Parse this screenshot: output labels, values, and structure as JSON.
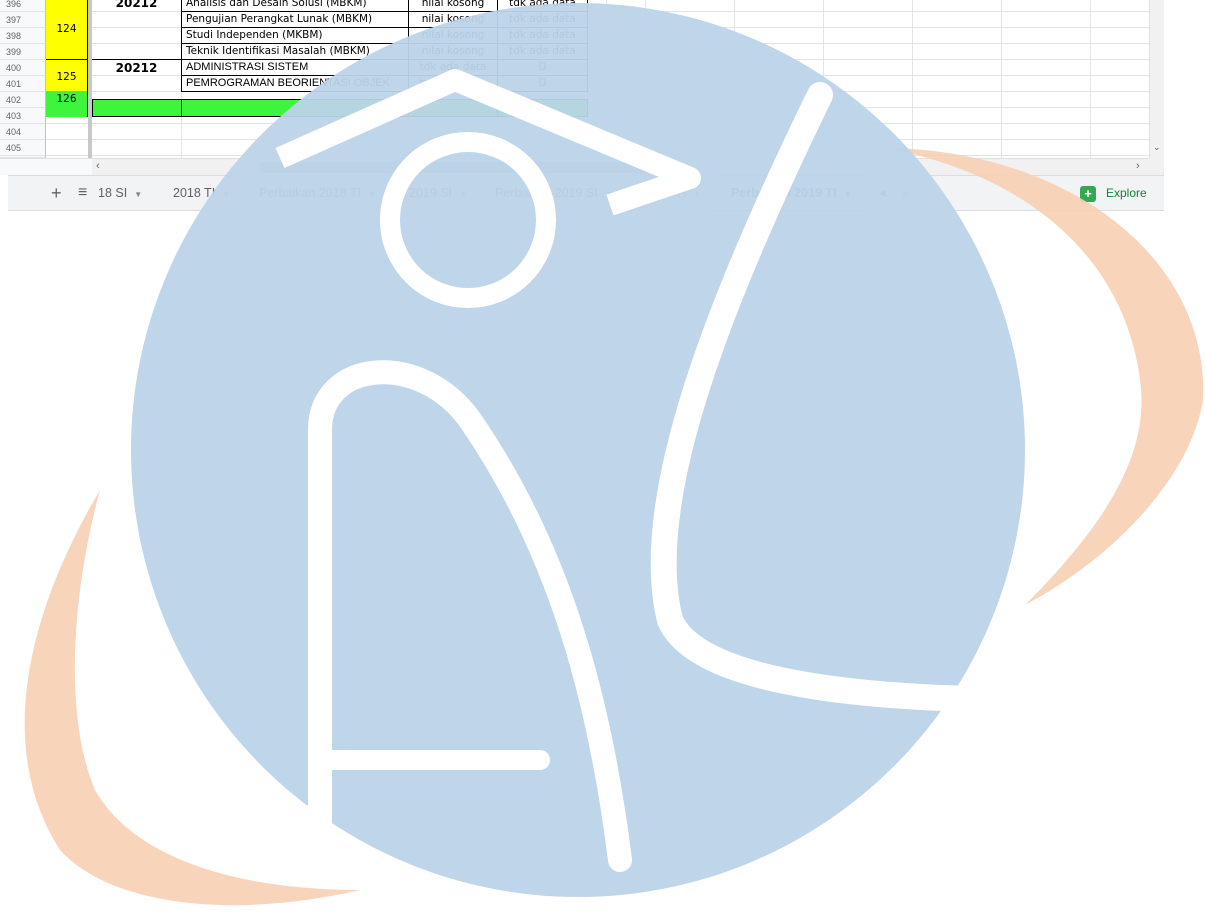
{
  "rows": [
    "396",
    "397",
    "398",
    "399",
    "400",
    "401",
    "402",
    "403",
    "404",
    "405"
  ],
  "groups": {
    "g124": "124",
    "g125": "125",
    "g126": "126"
  },
  "terms": {
    "t396": "20212",
    "t400": "20212"
  },
  "courses": [
    {
      "name": "Analisis dan Desain Solusi (MBKM)",
      "nilai": "nilai kosong",
      "status": "tdk ada data"
    },
    {
      "name": "Pengujian Perangkat Lunak (MBKM)",
      "nilai": "nilai kosong",
      "status": "tdk ada data"
    },
    {
      "name": "Studi Independen (MKBM)",
      "nilai": "nilai kosong",
      "status": "tdk ada data"
    },
    {
      "name": "Teknik Identifikasi Masalah (MBKM)",
      "nilai": "nilai kosong",
      "status": "tdk ada data"
    },
    {
      "name": "ADMINISTRASI SISTEM",
      "nilai": "tdk ada data",
      "status": "D"
    },
    {
      "name": "PEMROGRAMAN BEORIENTASI OBJEK",
      "nilai": "tdk ada data",
      "status": "D"
    }
  ],
  "tabs": [
    {
      "label": "18 SI"
    },
    {
      "label": "2018 TI"
    },
    {
      "label": "Perbaikan 2018 TI"
    },
    {
      "label": "2019 SI"
    },
    {
      "label": "Perbaikan 2019 SI"
    },
    {
      "label": "2019 TI"
    },
    {
      "label": "Perbaikan 2019 TI"
    }
  ],
  "toolbar": {
    "add": "+",
    "menu": "≡",
    "explore": "Explore"
  },
  "icons": {
    "add": "plus-icon",
    "sheets": "list-icon",
    "explore": "explore-icon"
  },
  "colors": {
    "active_tab": "#188038",
    "yellow": "#ffff00",
    "green": "#3df53d"
  }
}
